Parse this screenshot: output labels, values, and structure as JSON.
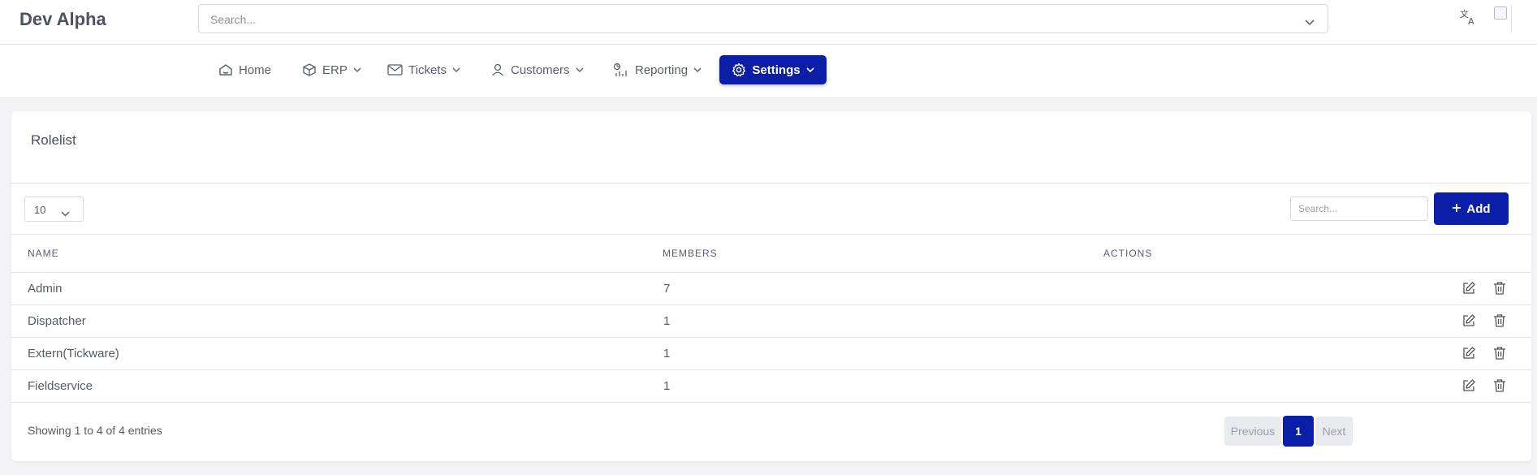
{
  "header": {
    "brand": "Dev Alpha",
    "search_placeholder": "Search...",
    "icons": {
      "language": "translate-icon",
      "avatar": "avatar-broken-image"
    }
  },
  "nav": {
    "items": [
      {
        "label": "Home",
        "icon": "home-icon"
      },
      {
        "label": "ERP",
        "icon": "box-icon"
      },
      {
        "label": "Tickets",
        "icon": "envelope-icon"
      },
      {
        "label": "Customers",
        "icon": "user-icon"
      },
      {
        "label": "Reporting",
        "icon": "chart-icon"
      },
      {
        "label": "Settings",
        "icon": "gear-icon",
        "active": true
      }
    ]
  },
  "card": {
    "title": "Rolelist",
    "page_length": "10",
    "search_placeholder": "Search...",
    "add_label": "Add"
  },
  "table": {
    "columns": [
      "NAME",
      "MEMBERS",
      "ACTIONS"
    ],
    "rows": [
      {
        "name": "Admin",
        "members": "7"
      },
      {
        "name": "Dispatcher",
        "members": "1"
      },
      {
        "name": "Extern(Tickware)",
        "members": "1"
      },
      {
        "name": "Fieldservice",
        "members": "1"
      }
    ]
  },
  "footer": {
    "info": "Showing 1 to 4 of 4 entries",
    "previous": "Previous",
    "current_page": "1",
    "next": "Next"
  },
  "colors": {
    "primary": "#0b1ea8",
    "background": "#f3f3f6"
  }
}
